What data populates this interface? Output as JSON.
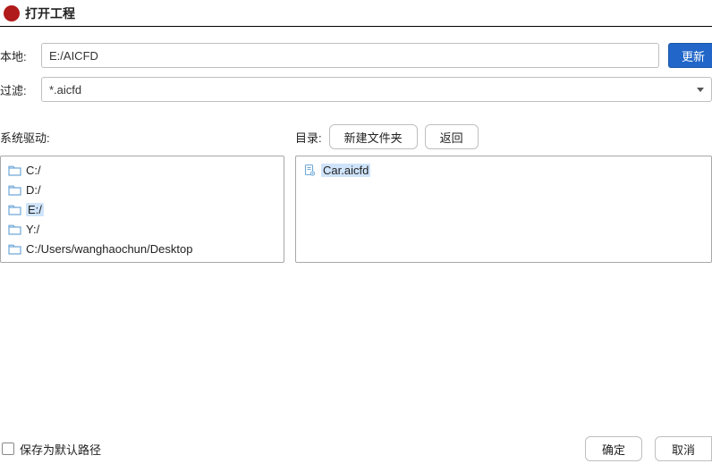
{
  "window": {
    "title": "打开工程",
    "app_icon_label": "AI"
  },
  "form": {
    "local_label": "本地:",
    "local_value": "E:/AICFD",
    "refresh_label": "更新",
    "filter_label": "过滤:",
    "filter_value": "*.aicfd"
  },
  "drives": {
    "label": "系统驱动:",
    "items": [
      {
        "name": "C:/",
        "selected": false
      },
      {
        "name": "D:/",
        "selected": false
      },
      {
        "name": "E:/",
        "selected": true
      },
      {
        "name": "Y:/",
        "selected": false
      },
      {
        "name": "C:/Users/wanghaochun/Desktop",
        "selected": false
      }
    ]
  },
  "directory": {
    "label": "目录:",
    "new_folder_label": "新建文件夹",
    "back_label": "返回",
    "items": [
      {
        "name": "Car.aicfd",
        "selected": true
      }
    ]
  },
  "footer": {
    "save_default_label": "保存为默认路径",
    "ok_label": "确定",
    "cancel_label": "取消"
  }
}
